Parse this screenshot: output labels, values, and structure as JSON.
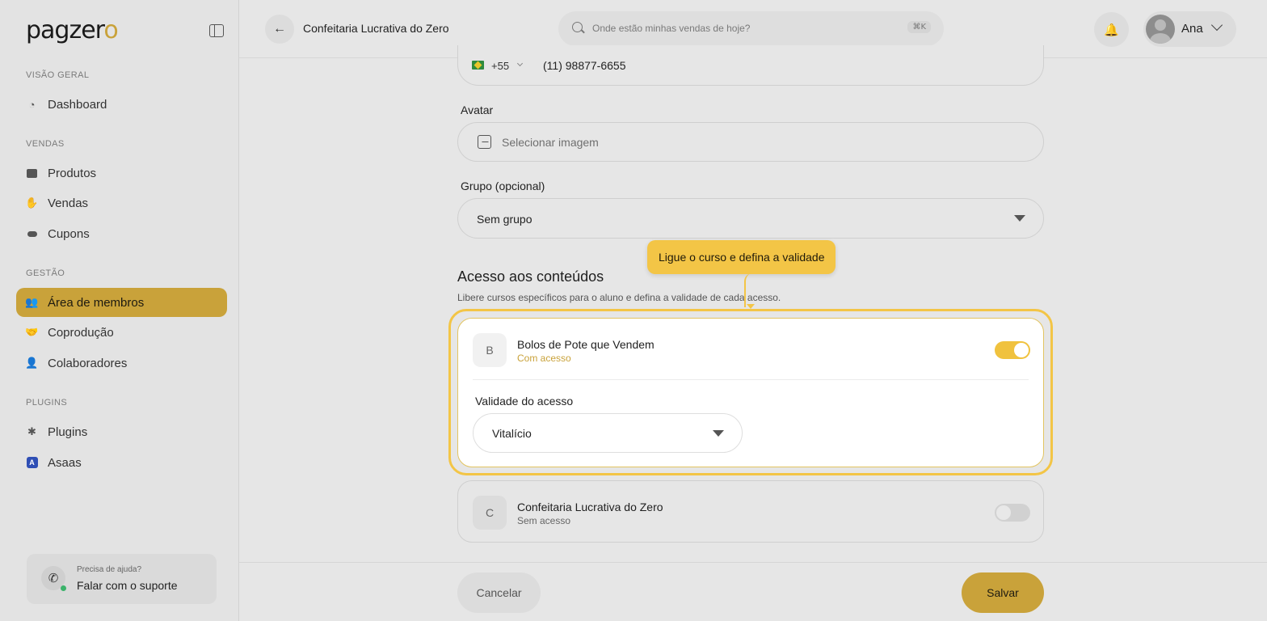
{
  "brand": {
    "logo_text": "pagzer",
    "logo_accent": "o",
    "accent_color": "#c9a23a"
  },
  "sidebar": {
    "sections": [
      {
        "title": "VISÃO GERAL"
      },
      {
        "title": "VENDAS"
      },
      {
        "title": "GESTÃO"
      },
      {
        "title": "PLUGINS"
      }
    ],
    "items": [
      {
        "label": "Dashboard",
        "icon": "dashboard-icon"
      },
      {
        "label": "Produtos",
        "icon": "products-icon"
      },
      {
        "label": "Vendas",
        "icon": "sales-icon"
      },
      {
        "label": "Cupons",
        "icon": "coupon-icon"
      },
      {
        "label": "Área de membros",
        "icon": "members-icon",
        "active": true
      },
      {
        "label": "Coprodução",
        "icon": "handshake-icon"
      },
      {
        "label": "Colaboradores",
        "icon": "collaborators-icon"
      },
      {
        "label": "Plugins",
        "icon": "puzzle-icon"
      },
      {
        "label": "Asaas",
        "icon": "asaas-icon",
        "icon_letter": "A"
      }
    ],
    "support": {
      "caption": "Precisa de ajuda?",
      "label": "Falar com o suporte"
    }
  },
  "header": {
    "title": "Confeitaria Lucrativa do Zero",
    "search_placeholder": "Onde estão minhas vendas de hoje?",
    "search_shortcut": "⌘K",
    "user_name": "Ana"
  },
  "form": {
    "phone": {
      "country_code": "+55",
      "value": "(11) 98877-6655"
    },
    "avatar": {
      "label": "Avatar",
      "placeholder": "Selecionar imagem"
    },
    "group": {
      "label": "Grupo (opcional)",
      "value": "Sem grupo"
    }
  },
  "access": {
    "title": "Acesso aos conteúdos",
    "subtitle": "Libere cursos específicos para o aluno e defina a validade de cada acesso.",
    "tooltip": "Ligue o curso e defina a validade",
    "courses": [
      {
        "letter": "B",
        "name": "Bolos de Pote que Vendem",
        "status": "Com acesso",
        "enabled": true,
        "validity_label": "Validade do acesso",
        "validity_value": "Vitalício"
      },
      {
        "letter": "C",
        "name": "Confeitaria Lucrativa do Zero",
        "status": "Sem acesso",
        "enabled": false
      }
    ]
  },
  "footer": {
    "cancel_label": "Cancelar",
    "save_label": "Salvar"
  }
}
